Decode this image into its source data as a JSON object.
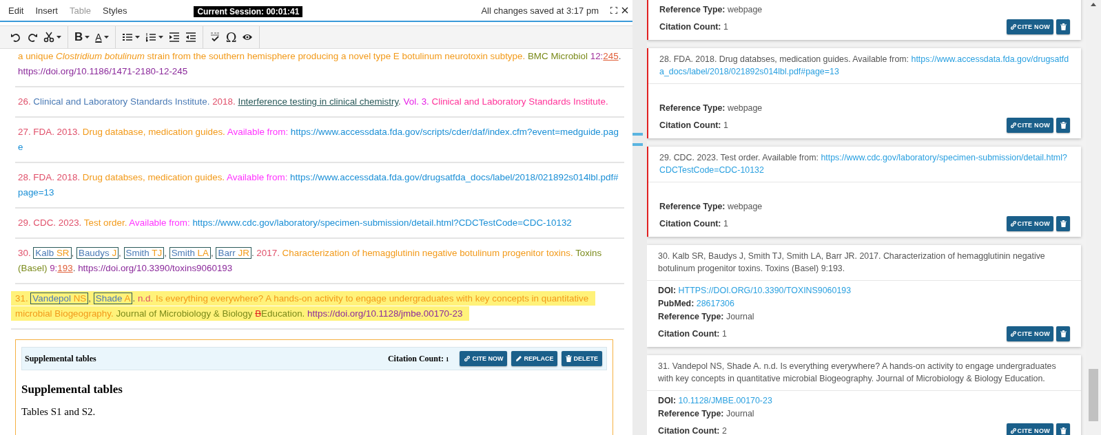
{
  "menubar": {
    "items": [
      {
        "label": "Edit",
        "disabled": false
      },
      {
        "label": "Insert",
        "disabled": false
      },
      {
        "label": "Table",
        "disabled": true
      },
      {
        "label": "Styles",
        "disabled": false
      }
    ],
    "session": "Current Session: 00:01:41",
    "save_status": "All changes saved at 3:17 pm"
  },
  "toolbar": {
    "bold_label": "B",
    "font_color_label": "A",
    "special_character": "Ω"
  },
  "references": [
    {
      "highlighted": false,
      "segments": [
        {
          "kind": "title",
          "text": "a unique *Clostridium botulinum* strain from the southern hemisphere producing a novel type E botulinum neurotoxin subtype."
        },
        {
          "kind": "source",
          "text": "BMC Microbiol"
        },
        {
          "kind": "issue",
          "text": "12:"
        },
        {
          "kind": "page",
          "text": "245"
        },
        {
          "kind": "punct",
          "text": "."
        },
        {
          "kind": "doi",
          "text": "https://doi.org/10.1186/1471-2180-12-245"
        }
      ]
    },
    {
      "highlighted": false,
      "segments": [
        {
          "kind": "num",
          "text": "26."
        },
        {
          "kind": "author",
          "text": "Clinical and Laboratory Standards Institute."
        },
        {
          "kind": "year",
          "text": "2018."
        },
        {
          "kind": "linked_title",
          "text": "Interference testing in clinical chemistry"
        },
        {
          "kind": "punct",
          "text": "."
        },
        {
          "kind": "vol",
          "text": "Vol. 3."
        },
        {
          "kind": "publisher",
          "text": "Clinical and Laboratory Standards Institute."
        }
      ]
    },
    {
      "highlighted": false,
      "segments": [
        {
          "kind": "num",
          "text": "27."
        },
        {
          "kind": "num",
          "text": "FDA."
        },
        {
          "kind": "num",
          "text": "2013."
        },
        {
          "kind": "title",
          "text": "Drug database, medication guides."
        },
        {
          "kind": "avail",
          "text": "Available from:"
        },
        {
          "kind": "url",
          "text": "https://www.accessdata.fda.gov/scripts/cder/daf/index.cfm?event=medguide.page"
        }
      ]
    },
    {
      "highlighted": false,
      "segments": [
        {
          "kind": "num",
          "text": "28."
        },
        {
          "kind": "num",
          "text": "FDA."
        },
        {
          "kind": "num",
          "text": "2018."
        },
        {
          "kind": "title",
          "text": "Drug databses, medication guides."
        },
        {
          "kind": "avail",
          "text": "Available from:"
        },
        {
          "kind": "url",
          "text": "https://www.accessdata.fda.gov/drugsatfda_docs/label/2018/021892s014lbl.pdf#page=13"
        }
      ]
    },
    {
      "highlighted": false,
      "segments": [
        {
          "kind": "num",
          "text": "29."
        },
        {
          "kind": "num",
          "text": "CDC."
        },
        {
          "kind": "num",
          "text": "2023."
        },
        {
          "kind": "title",
          "text": "Test order."
        },
        {
          "kind": "avail",
          "text": "Available from:"
        },
        {
          "kind": "url",
          "text": "https://www.cdc.gov/laboratory/specimen-submission/detail.html?CDCTestCode=CDC-10132"
        }
      ]
    },
    {
      "highlighted": false,
      "segments": [
        {
          "kind": "num",
          "text": "30."
        },
        {
          "kind": "author_box",
          "surname": "Kalb",
          "initials": "SR"
        },
        {
          "kind": "punct",
          "text": ","
        },
        {
          "kind": "author_box",
          "surname": "Baudys",
          "initials": "J"
        },
        {
          "kind": "punct",
          "text": ","
        },
        {
          "kind": "author_box",
          "surname": "Smith",
          "initials": "TJ"
        },
        {
          "kind": "punct",
          "text": ","
        },
        {
          "kind": "author_box",
          "surname": "Smith",
          "initials": "LA"
        },
        {
          "kind": "punct",
          "text": ","
        },
        {
          "kind": "author_box",
          "surname": "Barr",
          "initials": "JR"
        },
        {
          "kind": "punct",
          "text": "."
        },
        {
          "kind": "year",
          "text": "2017."
        },
        {
          "kind": "title",
          "text": "Characterization of hemagglutinin negative botulinum progenitor toxins."
        },
        {
          "kind": "source",
          "text": "Toxins (Basel)"
        },
        {
          "kind": "issue",
          "text": "9:"
        },
        {
          "kind": "page",
          "text": "193"
        },
        {
          "kind": "punct",
          "text": "."
        },
        {
          "kind": "doi",
          "text": "https://doi.org/10.3390/toxins9060193"
        }
      ]
    },
    {
      "highlighted": true,
      "segments": [
        {
          "kind": "title",
          "text": "31."
        },
        {
          "kind": "author_box",
          "surname": "Vandepol",
          "initials": "NS"
        },
        {
          "kind": "punct",
          "text": ","
        },
        {
          "kind": "author_box",
          "surname": "Shade",
          "initials": "A"
        },
        {
          "kind": "punct",
          "text": "."
        },
        {
          "kind": "year",
          "text": "n.d."
        },
        {
          "kind": "title",
          "text": "Is everything everywhere? A hands-on activity to engage undergraduates with key concepts in quantitative microbial Biogeography."
        },
        {
          "kind": "source",
          "text": "Journal of Microbiology & Biology"
        },
        {
          "kind": "deleted",
          "text": "B"
        },
        {
          "kind": "source",
          "text": "Education."
        },
        {
          "kind": "doi",
          "text": "https://doi.org/10.1128/jmbe.00170-23"
        }
      ]
    }
  ],
  "supplemental": {
    "header_title": "Supplemental tables",
    "citation_label": "Citation Count:",
    "citation_count": "1",
    "buttons": [
      {
        "kind": "cite",
        "label": "CITE NOW"
      },
      {
        "kind": "replace",
        "label": "REPLACE"
      },
      {
        "kind": "delete",
        "label": "DELETE"
      }
    ],
    "heading": "Supplemental tables",
    "body": "Tables S1 and S2."
  },
  "cards": [
    {
      "flagged": true,
      "fields": [
        {
          "label": "Reference Type:",
          "value": "webpage",
          "kind": "plain"
        }
      ],
      "citation_label": "Citation Count:",
      "citation_count": "1",
      "cite_label": "CITE NOW"
    },
    {
      "flagged": true,
      "text": "28. FDA. 2018. Drug databses, medication guides. Available from:",
      "link": "https://www.accessdata.fda.gov/drugsatfda_docs/label/2018/021892s014lbl.pdf#page=13",
      "fields": [
        {
          "label": "Reference Type:",
          "value": "webpage",
          "kind": "plain"
        }
      ],
      "citation_label": "Citation Count:",
      "citation_count": "1",
      "cite_label": "CITE NOW"
    },
    {
      "flagged": true,
      "text": "29. CDC. 2023. Test order. Available from:",
      "link": "https://www.cdc.gov/laboratory/specimen-submission/detail.html?CDCTestCode=CDC-10132",
      "fields": [
        {
          "label": "Reference Type:",
          "value": "webpage",
          "kind": "plain"
        }
      ],
      "citation_label": "Citation Count:",
      "citation_count": "1",
      "cite_label": "CITE NOW"
    },
    {
      "flagged": false,
      "text": "30. Kalb SR, Baudys J, Smith TJ, Smith LA, Barr JR. 2017. Characterization of hemagglutinin negative botulinum progenitor toxins. Toxins (Basel) 9:193.",
      "fields": [
        {
          "label": "DOI:",
          "value": "HTTPS://DOI.ORG/10.3390/TOXINS9060193",
          "kind": "link"
        },
        {
          "label": "PubMed:",
          "value": "28617306",
          "kind": "link"
        },
        {
          "label": "Reference Type:",
          "value": "Journal",
          "kind": "plain"
        }
      ],
      "citation_label": "Citation Count:",
      "citation_count": "1",
      "cite_label": "CITE NOW"
    },
    {
      "flagged": false,
      "text": "31. Vandepol NS, Shade A. n.d. Is everything everywhere? A hands-on activity to engage undergraduates with key concepts in quantitative microbial Biogeography. Journal of Microbiology & Biology Education.",
      "fields": [
        {
          "label": "DOI:",
          "value": "10.1128/JMBE.00170-23",
          "kind": "link"
        },
        {
          "label": "Reference Type:",
          "value": "Journal",
          "kind": "plain"
        }
      ],
      "citation_label": "Citation Count:",
      "citation_count": "2",
      "cite_label": "CITE NOW"
    }
  ]
}
